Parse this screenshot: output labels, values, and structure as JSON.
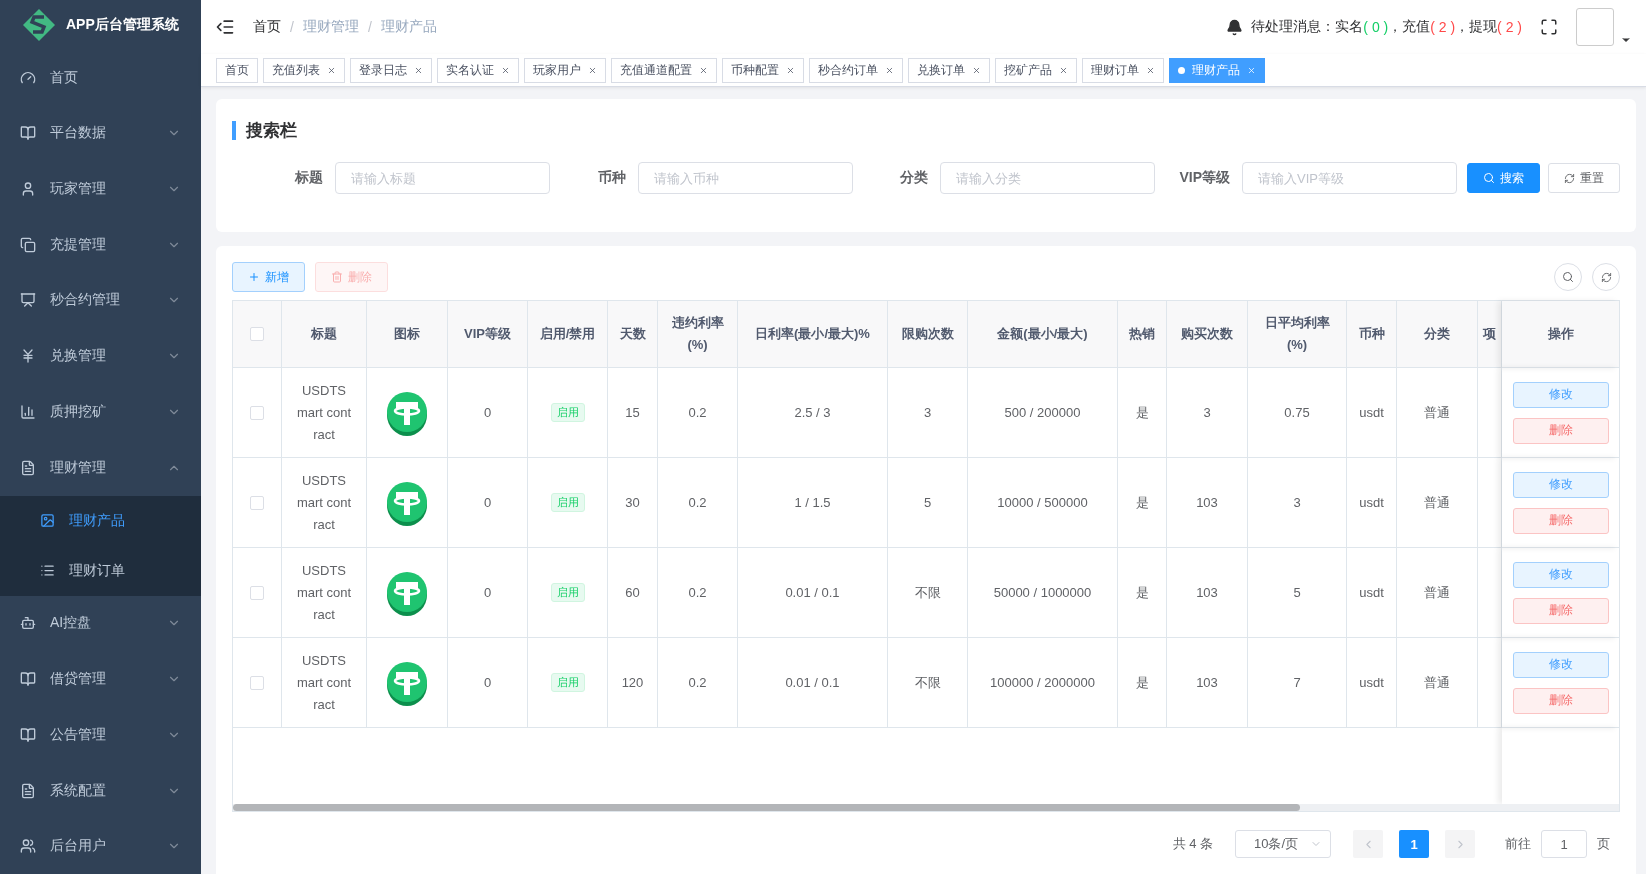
{
  "app": {
    "title": "APP后台管理系统"
  },
  "sidebar": {
    "items": [
      {
        "label": "首页",
        "kind": "link"
      },
      {
        "label": "平台数据",
        "kind": "group",
        "expanded": false
      },
      {
        "label": "玩家管理",
        "kind": "group",
        "expanded": false
      },
      {
        "label": "充提管理",
        "kind": "group",
        "expanded": false
      },
      {
        "label": "秒合约管理",
        "kind": "group",
        "expanded": false
      },
      {
        "label": "兑换管理",
        "kind": "group",
        "expanded": false
      },
      {
        "label": "质押挖矿",
        "kind": "group",
        "expanded": false
      },
      {
        "label": "理财管理",
        "kind": "group",
        "expanded": true,
        "children": [
          {
            "label": "理财产品",
            "selected": true
          },
          {
            "label": "理财订单",
            "selected": false
          }
        ]
      },
      {
        "label": "AI控盘",
        "kind": "group",
        "expanded": false
      },
      {
        "label": "借贷管理",
        "kind": "group",
        "expanded": false
      },
      {
        "label": "公告管理",
        "kind": "group",
        "expanded": false
      },
      {
        "label": "系统配置",
        "kind": "group",
        "expanded": false
      },
      {
        "label": "后台用户",
        "kind": "group",
        "expanded": false
      }
    ]
  },
  "breadcrumb": {
    "separator": "/",
    "items": [
      "首页",
      "理财管理",
      "理财产品"
    ]
  },
  "notice": {
    "label": "待处理消息：",
    "items": [
      {
        "name": "实名",
        "count": "( 0 )",
        "color": "#13ce66",
        "separator": "，"
      },
      {
        "name": "充值",
        "count": "( 2 )",
        "color": "#ff4949",
        "separator": "，"
      },
      {
        "name": "提现",
        "count": "( 2 )",
        "color": "#ff4949"
      }
    ]
  },
  "tags": [
    {
      "label": "首页",
      "selected": false,
      "closable": false
    },
    {
      "label": "充值列表",
      "selected": false,
      "closable": true
    },
    {
      "label": "登录日志",
      "selected": false,
      "closable": true
    },
    {
      "label": "实名认证",
      "selected": false,
      "closable": true
    },
    {
      "label": "玩家用户",
      "selected": false,
      "closable": true
    },
    {
      "label": "充值通道配置",
      "selected": false,
      "closable": true
    },
    {
      "label": "币种配置",
      "selected": false,
      "closable": true
    },
    {
      "label": "秒合约订单",
      "selected": false,
      "closable": true
    },
    {
      "label": "兑换订单",
      "selected": false,
      "closable": true
    },
    {
      "label": "挖矿产品",
      "selected": false,
      "closable": true
    },
    {
      "label": "理财订单",
      "selected": false,
      "closable": true
    },
    {
      "label": "理财产品",
      "selected": true,
      "closable": true
    }
  ],
  "search": {
    "title": "搜索栏",
    "fields": [
      {
        "label": "标题",
        "placeholder": "请输入标题"
      },
      {
        "label": "币种",
        "placeholder": "请输入币种"
      },
      {
        "label": "分类",
        "placeholder": "请输入分类"
      },
      {
        "label": "VIP等级",
        "placeholder": "请输入VIP等级"
      }
    ],
    "search_button": "搜索",
    "reset_button": "重置"
  },
  "toolbar": {
    "add": "新增",
    "delete": "删除",
    "delete_disabled": true
  },
  "table": {
    "header_checked": false,
    "columns": [
      "标题",
      "图标",
      "VIP等级",
      "启用/禁用",
      "天数",
      "违约利率(%)",
      "日利率(最小/最大)%",
      "限购次数",
      "金额(最小/最大)",
      "热销",
      "购买次数",
      "日平均利率(%)",
      "币种",
      "分类",
      "项",
      "操作"
    ],
    "rows": [
      {
        "checked": false,
        "title": "USDTS mart cont ract",
        "vip": "0",
        "status": "启用",
        "days": "15",
        "penalty": "0.2",
        "daily_rate": "2.5 / 3",
        "limit": "3",
        "amount": "500 / 200000",
        "hot": "是",
        "purchases": "3",
        "avg_rate": "0.75",
        "coin": "usdt",
        "category": "普通",
        "actions": [
          "修改",
          "删除"
        ]
      },
      {
        "checked": false,
        "title": "USDTS mart cont ract",
        "vip": "0",
        "status": "启用",
        "days": "30",
        "penalty": "0.2",
        "daily_rate": "1 / 1.5",
        "limit": "5",
        "amount": "10000 / 500000",
        "hot": "是",
        "purchases": "103",
        "avg_rate": "3",
        "coin": "usdt",
        "category": "普通",
        "actions": [
          "修改",
          "删除"
        ]
      },
      {
        "checked": false,
        "title": "USDTS mart cont ract",
        "vip": "0",
        "status": "启用",
        "days": "60",
        "penalty": "0.2",
        "daily_rate": "0.01 / 0.1",
        "limit": "不限",
        "amount": "50000 / 1000000",
        "hot": "是",
        "purchases": "103",
        "avg_rate": "5",
        "coin": "usdt",
        "category": "普通",
        "actions": [
          "修改",
          "删除"
        ]
      },
      {
        "checked": false,
        "title": "USDTS mart cont ract",
        "vip": "0",
        "status": "启用",
        "days": "120",
        "penalty": "0.2",
        "daily_rate": "0.01 / 0.1",
        "limit": "不限",
        "amount": "100000 / 2000000",
        "hot": "是",
        "purchases": "103",
        "avg_rate": "7",
        "coin": "usdt",
        "category": "普通",
        "actions": [
          "修改",
          "删除"
        ]
      }
    ]
  },
  "pagination": {
    "total": "共 4 条",
    "page_size": "10条/页",
    "pages": [
      {
        "label": "1",
        "selected": true
      }
    ],
    "goto_label": "前往",
    "goto_value": "1",
    "goto_suffix": "页"
  }
}
